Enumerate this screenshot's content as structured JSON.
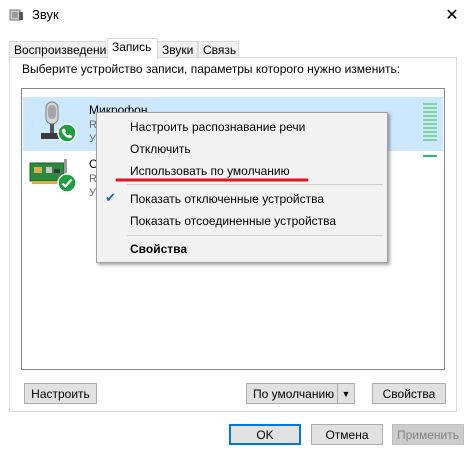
{
  "window": {
    "title": "Звук",
    "close_glyph": "✕"
  },
  "tabs": [
    "Воспроизведение",
    "Запись",
    "Звуки",
    "Связь"
  ],
  "active_tab": "Запись",
  "instruction": "Выберите устройство записи, параметры которого нужно изменить:",
  "devices": [
    {
      "name": "Микрофон",
      "sub_visible": "R",
      "sub2_visible": "У",
      "status": "default-communication",
      "selected": true
    },
    {
      "name_visible": "С",
      "sub_visible": "R",
      "sub2_visible": "У",
      "status": "ok",
      "selected": false
    }
  ],
  "context_menu": {
    "items": [
      {
        "label": "Настроить распознавание речи"
      },
      {
        "label": "Отключить"
      },
      {
        "label": "Использовать по умолчанию",
        "underlined_red": true
      },
      {
        "label": "Показать отключенные устройства",
        "checked": true
      },
      {
        "label": "Показать отсоединенные устройства"
      },
      {
        "label": "Свойства",
        "bold": true
      }
    ]
  },
  "buttons": {
    "configure": "Настроить",
    "set_default": "По умолчанию",
    "properties": "Свойства",
    "ok": "OK",
    "cancel": "Отмена",
    "apply": "Применить"
  },
  "colors": {
    "selection": "#cce8ff",
    "accent": "#0078d7",
    "status_green": "#1e9e3e",
    "annotation_red": "#e0141e"
  },
  "icons": [
    "sound-app-icon",
    "microphone-icon",
    "sound-card-icon",
    "phone-badge-icon",
    "check-badge-icon",
    "checkmark-icon",
    "dropdown-arrow-icon",
    "close-icon"
  ]
}
